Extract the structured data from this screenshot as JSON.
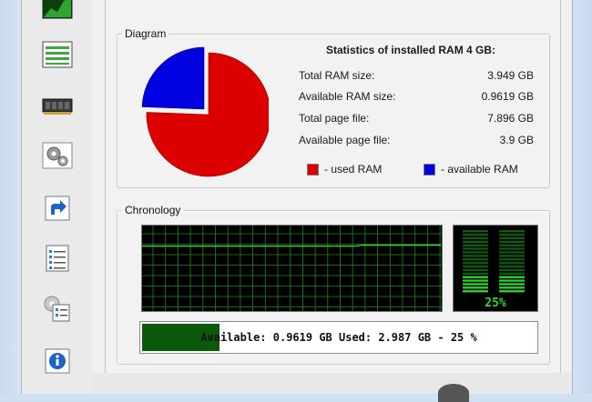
{
  "toolbar": {
    "items": [
      {
        "icon": "area-chart-icon",
        "active": true
      },
      {
        "icon": "list-lines-icon",
        "active": false
      },
      {
        "icon": "memory-chip-icon",
        "active": false
      },
      {
        "icon": "gears-icon",
        "active": false
      },
      {
        "icon": "shortcut-arrow-icon",
        "active": false
      },
      {
        "icon": "checklist-icon",
        "active": false
      },
      {
        "icon": "settings-checklist-icon",
        "active": false
      },
      {
        "icon": "info-icon",
        "active": false
      }
    ]
  },
  "diagram": {
    "legend": "Diagram",
    "stats_title": "Statistics of installed RAM 4 GB:",
    "stats": [
      {
        "label": "Total RAM size:",
        "value": "3.949 GB"
      },
      {
        "label": "Available RAM size:",
        "value": "0.9619 GB"
      },
      {
        "label": "Total page file:",
        "value": "7.896 GB"
      },
      {
        "label": "Available page file:",
        "value": "3.9 GB"
      }
    ],
    "legend_used": "- used RAM",
    "legend_available": "- available RAM",
    "colors": {
      "used": "#dd0000",
      "available": "#0000e0"
    },
    "pie": {
      "used_fraction": 0.756,
      "available_fraction": 0.244
    }
  },
  "chronology": {
    "legend": "Chronology",
    "grid_color": "#1a8a1a",
    "line_color": "#3cdc3c",
    "line_levels": [
      0.76,
      0.76,
      0.76,
      0.76,
      0.76,
      0.76,
      0.76,
      0.76,
      0.76,
      0.76,
      0.76,
      0.76,
      0.76,
      0.76,
      0.76,
      0.76,
      0.76,
      0.76,
      0.76,
      0.76,
      0.76,
      0.76,
      0.76,
      0.76,
      0.76,
      0.76,
      0.76,
      0.76,
      0.76,
      0.76,
      0.76,
      0.76,
      0.76,
      0.76,
      0.76,
      0.76,
      0.77,
      0.77,
      0.77,
      0.77,
      0.77,
      0.77,
      0.77,
      0.77,
      0.77,
      0.77,
      0.77,
      0.77,
      0.77,
      0.77
    ],
    "meter_percent": "25%",
    "meter_level": 0.25,
    "progress_text": "Available: 0.9619 GB  Used: 2.987 GB - 25 %",
    "progress_fraction": 0.195
  }
}
